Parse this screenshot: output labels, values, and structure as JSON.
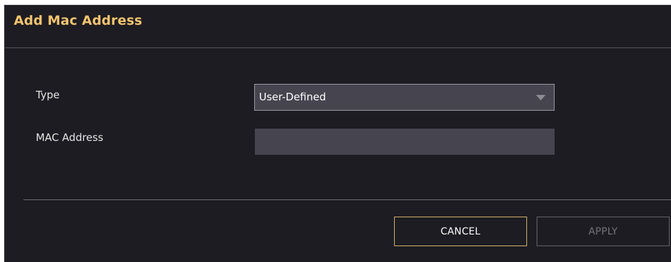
{
  "dialog": {
    "title": "Add Mac Address"
  },
  "form": {
    "type_label": "Type",
    "type_value": "User-Defined",
    "mac_label": "MAC Address",
    "mac_value": ""
  },
  "buttons": {
    "cancel_label": "CANCEL",
    "apply_label": "APPLY"
  },
  "colors": {
    "title": "#f2c46f",
    "background": "#1d1c22",
    "field": "#46454f",
    "cancel_border": "#d6b46b",
    "apply_disabled": "#76757b"
  }
}
